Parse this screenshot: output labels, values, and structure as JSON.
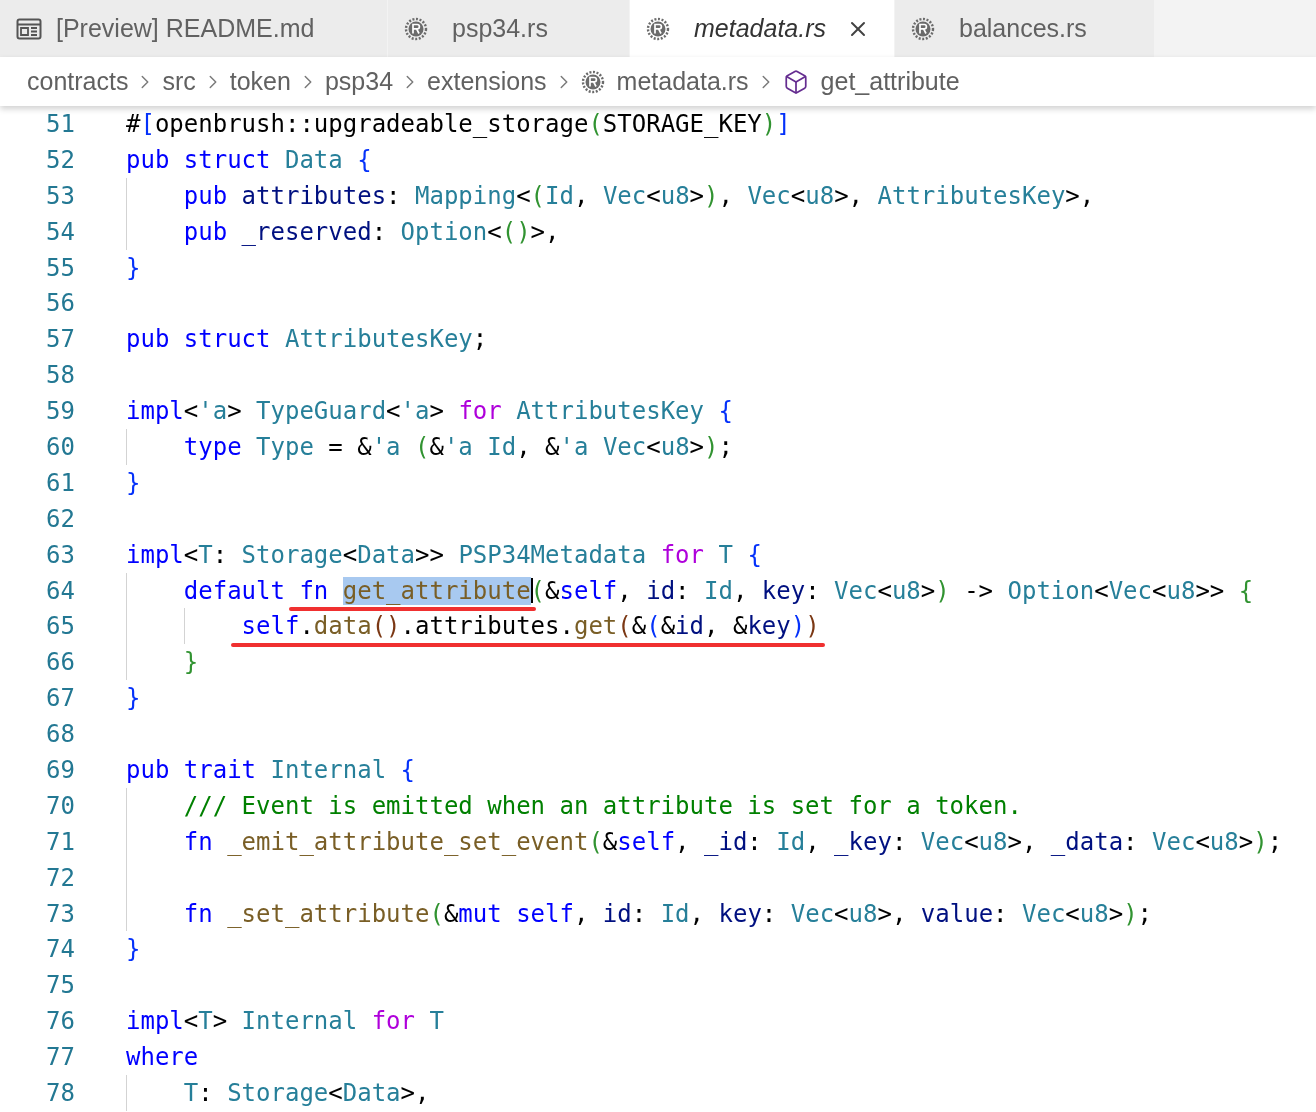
{
  "tabs": [
    {
      "label": "[Preview] README.md",
      "kind": "preview",
      "selected": false,
      "preview": false
    },
    {
      "label": "psp34.rs",
      "kind": "rust",
      "selected": false,
      "preview": false
    },
    {
      "label": "metadata.rs",
      "kind": "rust",
      "selected": true,
      "preview": true
    },
    {
      "label": "balances.rs",
      "kind": "rust",
      "selected": false,
      "preview": false
    }
  ],
  "breadcrumbs": [
    {
      "label": "contracts",
      "kind": "folder"
    },
    {
      "label": "src",
      "kind": "folder"
    },
    {
      "label": "token",
      "kind": "folder"
    },
    {
      "label": "psp34",
      "kind": "folder"
    },
    {
      "label": "extensions",
      "kind": "folder"
    },
    {
      "label": "metadata.rs",
      "kind": "rust"
    },
    {
      "label": "get_attribute",
      "kind": "method"
    }
  ],
  "lines": [
    {
      "number": "51",
      "segments": [
        {
          "text": "#",
          "kind": "plain"
        },
        {
          "text": "[",
          "kind": "b1"
        },
        {
          "text": "openbrush::upgradeable_storage",
          "kind": "plain"
        },
        {
          "text": "(",
          "kind": "b2"
        },
        {
          "text": "STORAGE_KEY",
          "kind": "plain"
        },
        {
          "text": ")",
          "kind": "b2"
        },
        {
          "text": "]",
          "kind": "b1"
        }
      ]
    },
    {
      "number": "52",
      "segments": [
        {
          "text": "pub struct ",
          "kind": "kw"
        },
        {
          "text": "Data ",
          "kind": "type"
        },
        {
          "text": "{",
          "kind": "b1"
        }
      ]
    },
    {
      "number": "53",
      "segments": [
        {
          "text": "    pub ",
          "kind": "kw"
        },
        {
          "text": "attributes",
          "kind": "var"
        },
        {
          "text": ": ",
          "kind": "plain"
        },
        {
          "text": "Mapping",
          "kind": "type"
        },
        {
          "text": "<",
          "kind": "plain"
        },
        {
          "text": "(",
          "kind": "b2"
        },
        {
          "text": "Id",
          "kind": "type"
        },
        {
          "text": ", ",
          "kind": "plain"
        },
        {
          "text": "Vec",
          "kind": "type"
        },
        {
          "text": "<",
          "kind": "plain"
        },
        {
          "text": "u8",
          "kind": "type"
        },
        {
          "text": ">",
          "kind": "plain"
        },
        {
          "text": ")",
          "kind": "b2"
        },
        {
          "text": ", ",
          "kind": "plain"
        },
        {
          "text": "Vec",
          "kind": "type"
        },
        {
          "text": "<",
          "kind": "plain"
        },
        {
          "text": "u8",
          "kind": "type"
        },
        {
          "text": ">, ",
          "kind": "plain"
        },
        {
          "text": "AttributesKey",
          "kind": "type"
        },
        {
          "text": ">,",
          "kind": "plain"
        }
      ]
    },
    {
      "number": "54",
      "segments": [
        {
          "text": "    pub ",
          "kind": "kw"
        },
        {
          "text": "_reserved",
          "kind": "var"
        },
        {
          "text": ": ",
          "kind": "plain"
        },
        {
          "text": "Option",
          "kind": "type"
        },
        {
          "text": "<",
          "kind": "plain"
        },
        {
          "text": "()",
          "kind": "b2"
        },
        {
          "text": ">,",
          "kind": "plain"
        }
      ]
    },
    {
      "number": "55",
      "segments": [
        {
          "text": "}",
          "kind": "b1"
        }
      ]
    },
    {
      "number": "56"
    },
    {
      "number": "57",
      "segments": [
        {
          "text": "pub struct ",
          "kind": "kw"
        },
        {
          "text": "AttributesKey",
          "kind": "type"
        },
        {
          "text": ";",
          "kind": "plain"
        }
      ]
    },
    {
      "number": "58"
    },
    {
      "number": "59",
      "segments": [
        {
          "text": "impl",
          "kind": "kw"
        },
        {
          "text": "<",
          "kind": "plain"
        },
        {
          "text": "'a",
          "kind": "life"
        },
        {
          "text": "> ",
          "kind": "plain"
        },
        {
          "text": "TypeGuard",
          "kind": "type"
        },
        {
          "text": "<",
          "kind": "plain"
        },
        {
          "text": "'a",
          "kind": "life"
        },
        {
          "text": "> ",
          "kind": "plain"
        },
        {
          "text": "for ",
          "kind": "ctrl"
        },
        {
          "text": "AttributesKey ",
          "kind": "type"
        },
        {
          "text": "{",
          "kind": "b1"
        }
      ]
    },
    {
      "number": "60",
      "segments": [
        {
          "text": "    type ",
          "kind": "kw"
        },
        {
          "text": "Type",
          "kind": "type"
        },
        {
          "text": " = &",
          "kind": "plain"
        },
        {
          "text": "'a ",
          "kind": "life"
        },
        {
          "text": "(",
          "kind": "b2"
        },
        {
          "text": "&",
          "kind": "plain"
        },
        {
          "text": "'a ",
          "kind": "life"
        },
        {
          "text": "Id",
          "kind": "type"
        },
        {
          "text": ", &",
          "kind": "plain"
        },
        {
          "text": "'a ",
          "kind": "life"
        },
        {
          "text": "Vec",
          "kind": "type"
        },
        {
          "text": "<",
          "kind": "plain"
        },
        {
          "text": "u8",
          "kind": "type"
        },
        {
          "text": ">",
          "kind": "plain"
        },
        {
          "text": ")",
          "kind": "b2"
        },
        {
          "text": ";",
          "kind": "plain"
        }
      ]
    },
    {
      "number": "61",
      "segments": [
        {
          "text": "}",
          "kind": "b1"
        }
      ]
    },
    {
      "number": "62"
    },
    {
      "number": "63",
      "segments": [
        {
          "text": "impl",
          "kind": "kw"
        },
        {
          "text": "<",
          "kind": "plain"
        },
        {
          "text": "T",
          "kind": "type"
        },
        {
          "text": ": ",
          "kind": "plain"
        },
        {
          "text": "Storage",
          "kind": "type"
        },
        {
          "text": "<",
          "kind": "plain"
        },
        {
          "text": "Data",
          "kind": "type"
        },
        {
          "text": ">> ",
          "kind": "plain"
        },
        {
          "text": "PSP34Metadata ",
          "kind": "type"
        },
        {
          "text": "for ",
          "kind": "ctrl"
        },
        {
          "text": "T ",
          "kind": "type"
        },
        {
          "text": "{",
          "kind": "b1"
        }
      ]
    },
    {
      "number": "64",
      "segments": [
        {
          "text": "    default ",
          "kind": "kw"
        },
        {
          "text": "fn ",
          "kind": "kw"
        },
        {
          "text": "get_attribute",
          "kind": "fn",
          "annotated": true,
          "selected": true,
          "cursor": true
        },
        {
          "text": "(",
          "kind": "b2"
        },
        {
          "text": "&",
          "kind": "plain"
        },
        {
          "text": "self",
          "kind": "kw"
        },
        {
          "text": ", ",
          "kind": "plain"
        },
        {
          "text": "id",
          "kind": "var"
        },
        {
          "text": ": ",
          "kind": "plain"
        },
        {
          "text": "Id",
          "kind": "type"
        },
        {
          "text": ", ",
          "kind": "plain"
        },
        {
          "text": "key",
          "kind": "var"
        },
        {
          "text": ": ",
          "kind": "plain"
        },
        {
          "text": "Vec",
          "kind": "type"
        },
        {
          "text": "<",
          "kind": "plain"
        },
        {
          "text": "u8",
          "kind": "type"
        },
        {
          "text": ">",
          "kind": "plain"
        },
        {
          "text": ")",
          "kind": "b2"
        },
        {
          "text": " -> ",
          "kind": "plain"
        },
        {
          "text": "Option",
          "kind": "type"
        },
        {
          "text": "<",
          "kind": "plain"
        },
        {
          "text": "Vec",
          "kind": "type"
        },
        {
          "text": "<",
          "kind": "plain"
        },
        {
          "text": "u8",
          "kind": "type"
        },
        {
          "text": ">> ",
          "kind": "plain"
        },
        {
          "text": "{",
          "kind": "b2"
        }
      ]
    },
    {
      "number": "65",
      "annotated": true,
      "segments": [
        {
          "text": "        self",
          "kind": "kw"
        },
        {
          "text": ".",
          "kind": "plain"
        },
        {
          "text": "data",
          "kind": "fn"
        },
        {
          "text": "()",
          "kind": "b3"
        },
        {
          "text": ".attributes.",
          "kind": "plain"
        },
        {
          "text": "get",
          "kind": "fn"
        },
        {
          "text": "(",
          "kind": "b3"
        },
        {
          "text": "&",
          "kind": "plain"
        },
        {
          "text": "(",
          "kind": "b1"
        },
        {
          "text": "&",
          "kind": "plain"
        },
        {
          "text": "id",
          "kind": "var"
        },
        {
          "text": ", &",
          "kind": "plain"
        },
        {
          "text": "key",
          "kind": "var"
        },
        {
          "text": ")",
          "kind": "b1"
        },
        {
          "text": ")",
          "kind": "b3"
        }
      ]
    },
    {
      "number": "66",
      "segments": [
        {
          "text": "    }",
          "kind": "b2"
        }
      ]
    },
    {
      "number": "67",
      "segments": [
        {
          "text": "}",
          "kind": "b1"
        }
      ]
    },
    {
      "number": "68"
    },
    {
      "number": "69",
      "segments": [
        {
          "text": "pub trait ",
          "kind": "kw"
        },
        {
          "text": "Internal ",
          "kind": "type"
        },
        {
          "text": "{",
          "kind": "b1"
        }
      ]
    },
    {
      "number": "70",
      "segments": [
        {
          "text": "    /// Event is emitted when an attribute is set for a token.",
          "kind": "comment"
        }
      ]
    },
    {
      "number": "71",
      "segments": [
        {
          "text": "    fn ",
          "kind": "kw"
        },
        {
          "text": "_emit_attribute_set_event",
          "kind": "fn"
        },
        {
          "text": "(",
          "kind": "b2"
        },
        {
          "text": "&",
          "kind": "plain"
        },
        {
          "text": "self",
          "kind": "kw"
        },
        {
          "text": ", ",
          "kind": "plain"
        },
        {
          "text": "_id",
          "kind": "var"
        },
        {
          "text": ": ",
          "kind": "plain"
        },
        {
          "text": "Id",
          "kind": "type"
        },
        {
          "text": ", ",
          "kind": "plain"
        },
        {
          "text": "_key",
          "kind": "var"
        },
        {
          "text": ": ",
          "kind": "plain"
        },
        {
          "text": "Vec",
          "kind": "type"
        },
        {
          "text": "<",
          "kind": "plain"
        },
        {
          "text": "u8",
          "kind": "type"
        },
        {
          "text": ">, ",
          "kind": "plain"
        },
        {
          "text": "_data",
          "kind": "var"
        },
        {
          "text": ": ",
          "kind": "plain"
        },
        {
          "text": "Vec",
          "kind": "type"
        },
        {
          "text": "<",
          "kind": "plain"
        },
        {
          "text": "u8",
          "kind": "type"
        },
        {
          "text": ">",
          "kind": "plain"
        },
        {
          "text": ")",
          "kind": "b2"
        },
        {
          "text": ";",
          "kind": "plain"
        }
      ]
    },
    {
      "number": "72"
    },
    {
      "number": "73",
      "segments": [
        {
          "text": "    fn ",
          "kind": "kw"
        },
        {
          "text": "_set_attribute",
          "kind": "fn"
        },
        {
          "text": "(",
          "kind": "b2"
        },
        {
          "text": "&",
          "kind": "plain"
        },
        {
          "text": "mut self",
          "kind": "kw"
        },
        {
          "text": ", ",
          "kind": "plain"
        },
        {
          "text": "id",
          "kind": "var"
        },
        {
          "text": ": ",
          "kind": "plain"
        },
        {
          "text": "Id",
          "kind": "type"
        },
        {
          "text": ", ",
          "kind": "plain"
        },
        {
          "text": "key",
          "kind": "var"
        },
        {
          "text": ": ",
          "kind": "plain"
        },
        {
          "text": "Vec",
          "kind": "type"
        },
        {
          "text": "<",
          "kind": "plain"
        },
        {
          "text": "u8",
          "kind": "type"
        },
        {
          "text": ">, ",
          "kind": "plain"
        },
        {
          "text": "value",
          "kind": "var"
        },
        {
          "text": ": ",
          "kind": "plain"
        },
        {
          "text": "Vec",
          "kind": "type"
        },
        {
          "text": "<",
          "kind": "plain"
        },
        {
          "text": "u8",
          "kind": "type"
        },
        {
          "text": ">",
          "kind": "plain"
        },
        {
          "text": ")",
          "kind": "b2"
        },
        {
          "text": ";",
          "kind": "plain"
        }
      ]
    },
    {
      "number": "74",
      "segments": [
        {
          "text": "}",
          "kind": "b1"
        }
      ]
    },
    {
      "number": "75"
    },
    {
      "number": "76",
      "segments": [
        {
          "text": "impl",
          "kind": "kw"
        },
        {
          "text": "<",
          "kind": "plain"
        },
        {
          "text": "T",
          "kind": "type"
        },
        {
          "text": "> ",
          "kind": "plain"
        },
        {
          "text": "Internal ",
          "kind": "type"
        },
        {
          "text": "for ",
          "kind": "ctrl"
        },
        {
          "text": "T",
          "kind": "type"
        }
      ]
    },
    {
      "number": "77",
      "segments": [
        {
          "text": "where",
          "kind": "kw"
        }
      ]
    },
    {
      "number": "78",
      "segments": [
        {
          "text": "    T",
          "kind": "type"
        },
        {
          "text": ": ",
          "kind": "plain"
        },
        {
          "text": "Storage",
          "kind": "type"
        },
        {
          "text": "<",
          "kind": "plain"
        },
        {
          "text": "Data",
          "kind": "type"
        },
        {
          "text": ">,",
          "kind": "plain"
        }
      ]
    }
  ]
}
